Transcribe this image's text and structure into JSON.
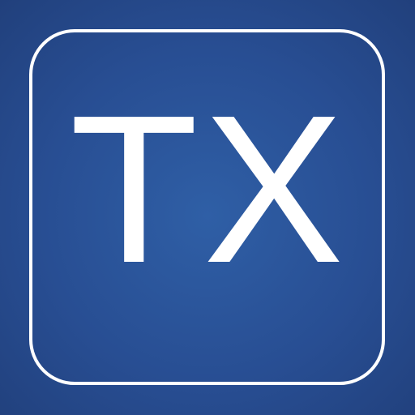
{
  "app_icon": {
    "label": "TX",
    "colors": {
      "background": "#2a559b",
      "frame": "#ffffff",
      "text": "#ffffff"
    }
  }
}
